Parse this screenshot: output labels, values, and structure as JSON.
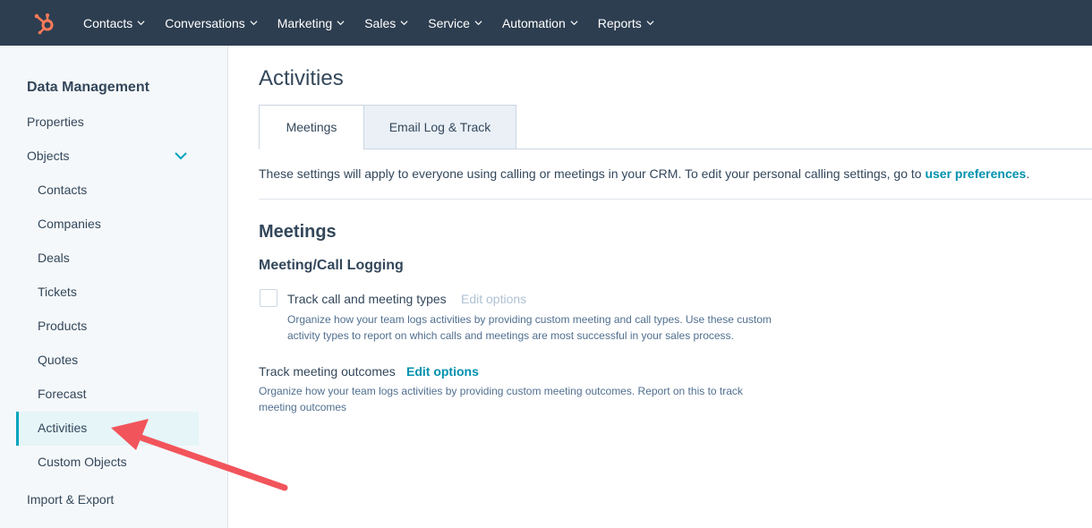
{
  "nav": {
    "items": [
      {
        "label": "Contacts"
      },
      {
        "label": "Conversations"
      },
      {
        "label": "Marketing"
      },
      {
        "label": "Sales"
      },
      {
        "label": "Service"
      },
      {
        "label": "Automation"
      },
      {
        "label": "Reports"
      }
    ],
    "logo_icon": "hubspot-sprocket-icon",
    "colors": {
      "bar": "#2d3e50",
      "logo": "#ff7a59"
    }
  },
  "sidebar": {
    "title": "Data Management",
    "properties": "Properties",
    "objects": "Objects",
    "sub_items": [
      "Contacts",
      "Companies",
      "Deals",
      "Tickets",
      "Products",
      "Quotes",
      "Forecast",
      "Activities",
      "Custom Objects"
    ],
    "active": "Activities",
    "import_export": "Import & Export"
  },
  "main": {
    "title": "Activities",
    "tabs": [
      {
        "label": "Meetings",
        "active": true
      },
      {
        "label": "Email Log & Track",
        "active": false
      }
    ],
    "settings_text": "These settings will apply to everyone using calling or meetings in your CRM. To edit your personal calling settings, go to ",
    "settings_link": "user preferences",
    "settings_end": ".",
    "section_title": "Meetings",
    "subsection_title": "Meeting/Call Logging",
    "track_label": "Track call and meeting types",
    "track_checked": false,
    "track_edit": "Edit options",
    "track_desc": "Organize how your team logs activities by providing custom meeting and call types. Use these custom activity types to report on which calls and meetings are most successful in your sales process.",
    "outcomes_label": "Track meeting outcomes",
    "outcomes_edit": "Edit options",
    "outcomes_desc": "Organize how your team logs activities by providing custom meeting outcomes. Report on this to track meeting outcomes"
  },
  "colors": {
    "accent": "#00a4bd",
    "link": "#0091ae",
    "annotation_arrow": "#f2545b"
  }
}
